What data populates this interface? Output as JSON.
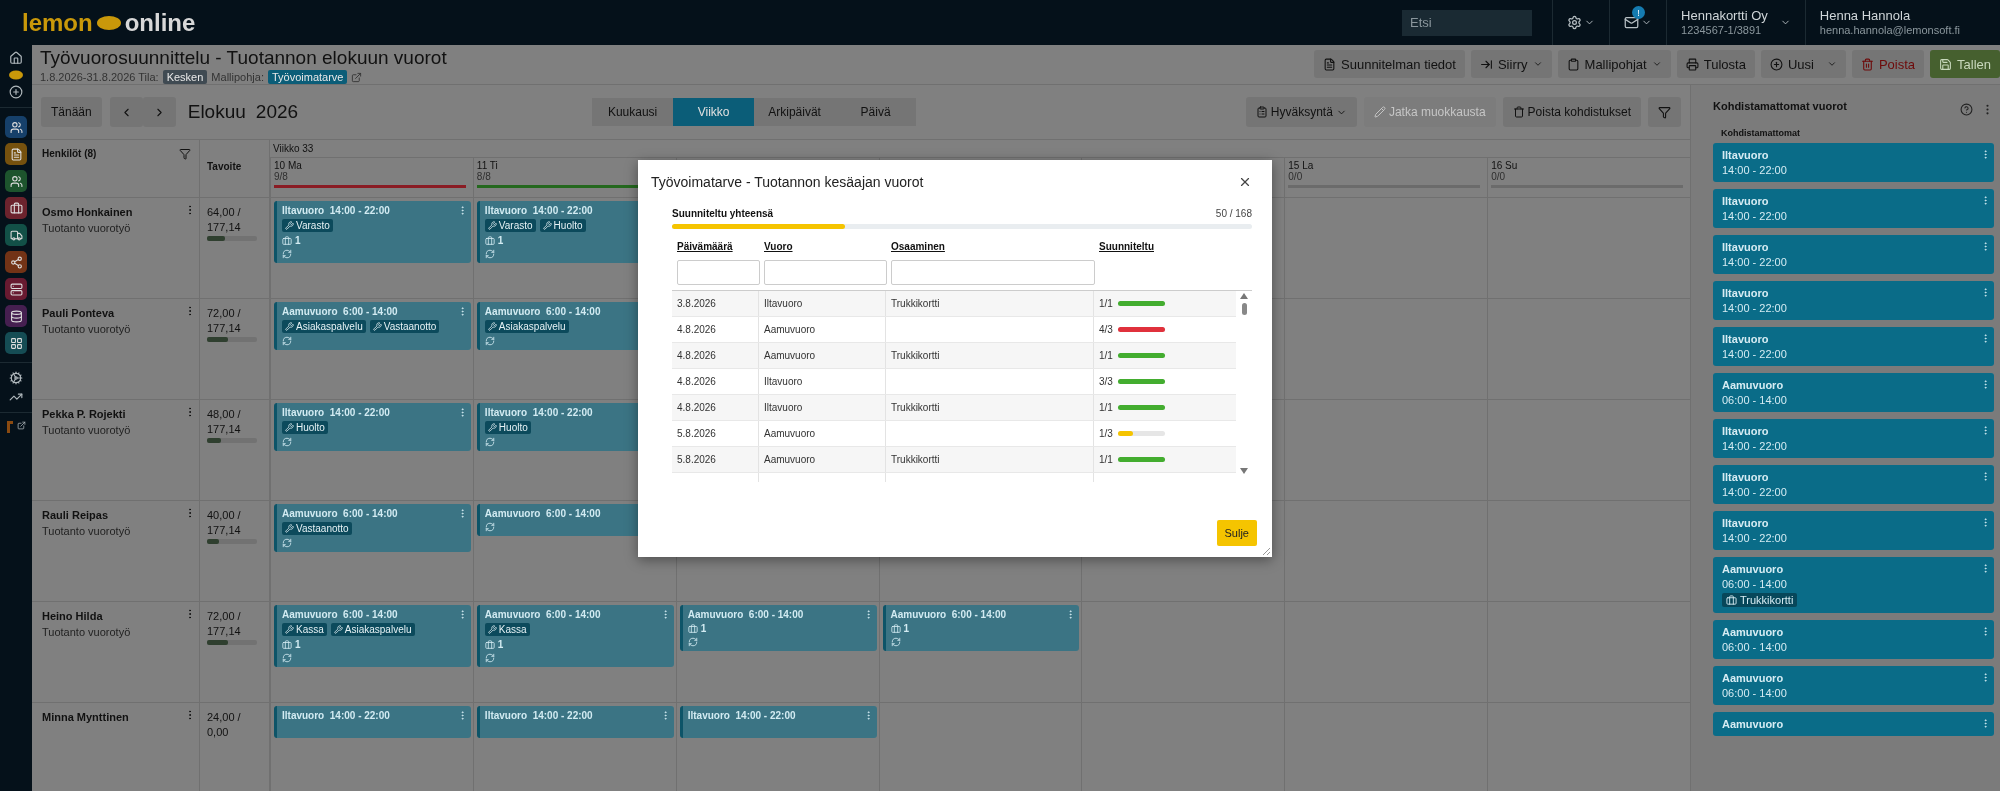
{
  "topbar": {
    "logo_left": "lemon",
    "logo_right": "online",
    "search": {
      "placeholder": "Etsi"
    },
    "mail_badge": "!",
    "company": {
      "name": "Hennakortti Oy",
      "id": "1234567-1/3891"
    },
    "user": {
      "name": "Henna Hannola",
      "email": "henna.hannola@lemonsoft.fi"
    }
  },
  "page": {
    "title": "Työvuorosuunnittelu - Tuotannon elokuun vuorot",
    "period": "1.8.2026-31.8.2026 Tila:",
    "state": "Kesken",
    "template_label": "Mallipohja:",
    "template": "Työvoimatarve"
  },
  "actions": [
    {
      "label": "Suunnitelman tiedot",
      "kind": "plain"
    },
    {
      "label": "Siirry",
      "kind": "dropdown"
    },
    {
      "label": "Mallipohjat",
      "kind": "dropdown"
    },
    {
      "label": "Tulosta",
      "kind": "plain"
    },
    {
      "label": "Uusi",
      "kind": "split"
    },
    {
      "label": "Poista",
      "kind": "danger"
    },
    {
      "label": "Tallen",
      "kind": "save"
    }
  ],
  "calendar_toolbar": {
    "today": "Tänään",
    "month": "Elokuu",
    "year": "2026",
    "views": [
      {
        "label": "Kuukausi",
        "selected": false
      },
      {
        "label": "Viikko",
        "selected": true
      },
      {
        "label": "Arkipäivät",
        "selected": false
      },
      {
        "label": "Päivä",
        "selected": false
      }
    ],
    "tools": [
      {
        "label": "Hyväksyntä",
        "kind": "dropdown",
        "disabled": false
      },
      {
        "label": "Jatka muokkausta",
        "kind": "edit",
        "disabled": true
      },
      {
        "label": "Poista kohdistukset",
        "kind": "delete",
        "disabled": false
      }
    ]
  },
  "grid": {
    "people_header": "Henkilöt (8)",
    "target_header": "Tavoite",
    "week": "Viikko 33",
    "week_start": [
      {
        "label": "10 Ma",
        "count": "9/8",
        "color": "#8a1c24"
      },
      {
        "label": "11 Ti",
        "count": "8/8",
        "color": "#24681e"
      }
    ],
    "week_end": [
      {
        "label": "15 La",
        "count": "0/0",
        "color": "#6b6b6b"
      },
      {
        "label": "16 Su",
        "count": "0/0",
        "color": "#6b6b6b"
      }
    ],
    "rows": [
      {
        "name": "Osmo Honkainen",
        "role": "Tuotanto vuorotyö",
        "hours": "64,00 /",
        "target": "177,14",
        "level": 0.36,
        "cells": [
          {
            "shift": {
              "title": "Iltavuoro  14:00 - 22:00",
              "skills": [
                "Varasto"
              ],
              "count": "1",
              "confirmed": true
            }
          },
          {
            "shift": {
              "title": "Iltavuoro  14:00 - 22:00",
              "skills": [
                "Varasto",
                "Huolto"
              ],
              "count": "1",
              "confirmed": true
            }
          },
          {},
          {},
          {},
          {},
          {}
        ]
      },
      {
        "name": "Pauli Ponteva",
        "role": "Tuotanto vuorotyö",
        "hours": "72,00 /",
        "target": "177,14",
        "level": 0.41,
        "cells": [
          {
            "shift": {
              "title": "Aamuvuoro  6:00 - 14:00",
              "skills": [
                "Asiakaspalvelu",
                "Vastaanotto"
              ],
              "confirmed": true
            }
          },
          {
            "shift": {
              "title": "Aamuvuoro  6:00 - 14:00",
              "skills": [
                "Asiakaspalvelu"
              ],
              "confirmed": true
            }
          },
          {},
          {},
          {},
          {},
          {}
        ]
      },
      {
        "name": "Pekka P. Rojekti",
        "role": "Tuotanto vuorotyö",
        "hours": "48,00 /",
        "target": "177,14",
        "level": 0.27,
        "cells": [
          {
            "shift": {
              "title": "Iltavuoro  14:00 - 22:00",
              "skills": [
                "Huolto"
              ],
              "confirmed": true
            }
          },
          {
            "shift": {
              "title": "Iltavuoro  14:00 - 22:00",
              "skills": [
                "Huolto"
              ],
              "confirmed": true
            }
          },
          {},
          {},
          {},
          {},
          {}
        ]
      },
      {
        "name": "Rauli Reipas",
        "role": "Tuotanto vuorotyö",
        "hours": "40,00 /",
        "target": "177,14",
        "level": 0.23,
        "cells": [
          {
            "shift": {
              "title": "Aamuvuoro  6:00 - 14:00",
              "skills": [
                "Vastaanotto"
              ],
              "confirmed": true
            }
          },
          {
            "shift": {
              "title": "Aamuvuoro  6:00 - 14:00",
              "confirmed": true
            }
          },
          {},
          {},
          {},
          {},
          {}
        ]
      },
      {
        "name": "Heino Hilda",
        "role": "Tuotanto vuorotyö",
        "hours": "72,00 /",
        "target": "177,14",
        "level": 0.41,
        "cells": [
          {
            "shift": {
              "title": "Aamuvuoro  6:00 - 14:00",
              "skills": [
                "Kassa",
                "Asiakaspalvelu"
              ],
              "count": "1",
              "confirmed": true
            }
          },
          {
            "shift": {
              "title": "Aamuvuoro  6:00 - 14:00",
              "skills": [
                "Kassa"
              ],
              "count": "1",
              "confirmed": true
            }
          },
          {
            "shift": {
              "title": "Aamuvuoro  6:00 - 14:00",
              "count": "1",
              "confirmed": true
            }
          },
          {
            "shift": {
              "title": "Aamuvuoro  6:00 - 14:00",
              "count": "1",
              "confirmed": true
            }
          },
          {},
          {},
          {}
        ]
      },
      {
        "name": "Minna Mynttinen",
        "hours": "24,00 /",
        "target": "0,00",
        "cells": [
          {
            "shift": {
              "title": "Iltavuoro  14:00 - 22:00",
              "confirmed": false
            }
          },
          {
            "shift": {
              "title": "Iltavuoro  14:00 - 22:00",
              "confirmed": false
            }
          },
          {
            "shift": {
              "title": "Iltavuoro  14:00 - 22:00",
              "confirmed": false
            }
          },
          {},
          {},
          {},
          {}
        ]
      }
    ]
  },
  "unassigned": {
    "title": "Kohdistamattomat vuorot",
    "subtitle": "Kohdistamattomat",
    "shifts": [
      {
        "name": "Iltavuoro",
        "time": "14:00 - 22:00"
      },
      {
        "name": "Iltavuoro",
        "time": "14:00 - 22:00"
      },
      {
        "name": "Iltavuoro",
        "time": "14:00 - 22:00"
      },
      {
        "name": "Iltavuoro",
        "time": "14:00 - 22:00"
      },
      {
        "name": "Iltavuoro",
        "time": "14:00 - 22:00"
      },
      {
        "name": "Aamuvuoro",
        "time": "06:00 - 14:00"
      },
      {
        "name": "Iltavuoro",
        "time": "14:00 - 22:00"
      },
      {
        "name": "Iltavuoro",
        "time": "14:00 - 22:00"
      },
      {
        "name": "Iltavuoro",
        "time": "14:00 - 22:00"
      },
      {
        "name": "Aamuvuoro",
        "time": "06:00 - 14:00",
        "skill": "Trukkikortti"
      },
      {
        "name": "Aamuvuoro",
        "time": "06:00 - 14:00"
      },
      {
        "name": "Aamuvuoro",
        "time": "06:00 - 14:00"
      },
      {
        "name": "Aamuvuoro"
      }
    ]
  },
  "modal": {
    "title": "Työvoimatarve - Tuotannon kesäajan vuorot",
    "total_label": "Suunniteltu yhteensä",
    "total": "50 / 168",
    "level": 0.298,
    "columns": [
      {
        "label": "Päivämäärä",
        "kind": "filter"
      },
      {
        "label": "Vuoro",
        "kind": "filter"
      },
      {
        "label": "Osaaminen",
        "kind": "filter"
      },
      {
        "label": "Suunniteltu",
        "kind": "plain"
      }
    ],
    "rows": [
      {
        "date": "3.8.2026",
        "shift": "Iltavuoro",
        "skill": "Trukkikortti",
        "planned": "1/1",
        "level": 1,
        "color": "#43ad2f"
      },
      {
        "date": "4.8.2026",
        "shift": "Aamuvuoro",
        "planned": "4/3",
        "level": 1,
        "color": "#e0313c"
      },
      {
        "date": "4.8.2026",
        "shift": "Aamuvuoro",
        "skill": "Trukkikortti",
        "planned": "1/1",
        "level": 1,
        "color": "#43ad2f"
      },
      {
        "date": "4.8.2026",
        "shift": "Iltavuoro",
        "planned": "3/3",
        "level": 1,
        "color": "#43ad2f"
      },
      {
        "date": "4.8.2026",
        "shift": "Iltavuoro",
        "skill": "Trukkikortti",
        "planned": "1/1",
        "level": 1,
        "color": "#43ad2f"
      },
      {
        "date": "5.8.2026",
        "shift": "Aamuvuoro",
        "planned": "1/3",
        "level": 0.33,
        "color": "#f5c400"
      },
      {
        "date": "5.8.2026",
        "shift": "Aamuvuoro",
        "skill": "Trukkikortti",
        "planned": "1/1",
        "level": 1,
        "color": "#43ad2f"
      }
    ],
    "close_button": "Sulje"
  }
}
